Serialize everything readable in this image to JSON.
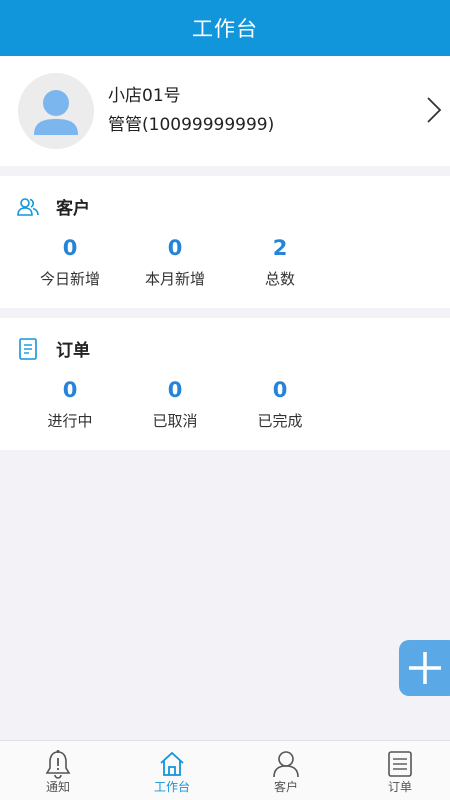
{
  "header": {
    "title": "工作台"
  },
  "profile": {
    "shop_name": "小店01号",
    "user_line": "管管(10099999999)"
  },
  "customer": {
    "title": "客户",
    "stats": [
      {
        "value": "0",
        "label": "今日新增"
      },
      {
        "value": "0",
        "label": "本月新增"
      },
      {
        "value": "2",
        "label": "总数"
      }
    ]
  },
  "order": {
    "title": "订单",
    "stats": [
      {
        "value": "0",
        "label": "进行中"
      },
      {
        "value": "0",
        "label": "已取消"
      },
      {
        "value": "0",
        "label": "已完成"
      }
    ]
  },
  "fab": {
    "icon": "plus-icon"
  },
  "tabbar": {
    "items": [
      {
        "label": "通知",
        "icon": "bell-icon",
        "active": false
      },
      {
        "label": "工作台",
        "icon": "home-icon",
        "active": true
      },
      {
        "label": "客户",
        "icon": "user-icon",
        "active": false
      },
      {
        "label": "订单",
        "icon": "document-icon",
        "active": false
      }
    ]
  },
  "colors": {
    "primary": "#1296db",
    "stat_value": "#2583d8",
    "fab": "#5aa9e6",
    "background": "#f3f3f7"
  }
}
